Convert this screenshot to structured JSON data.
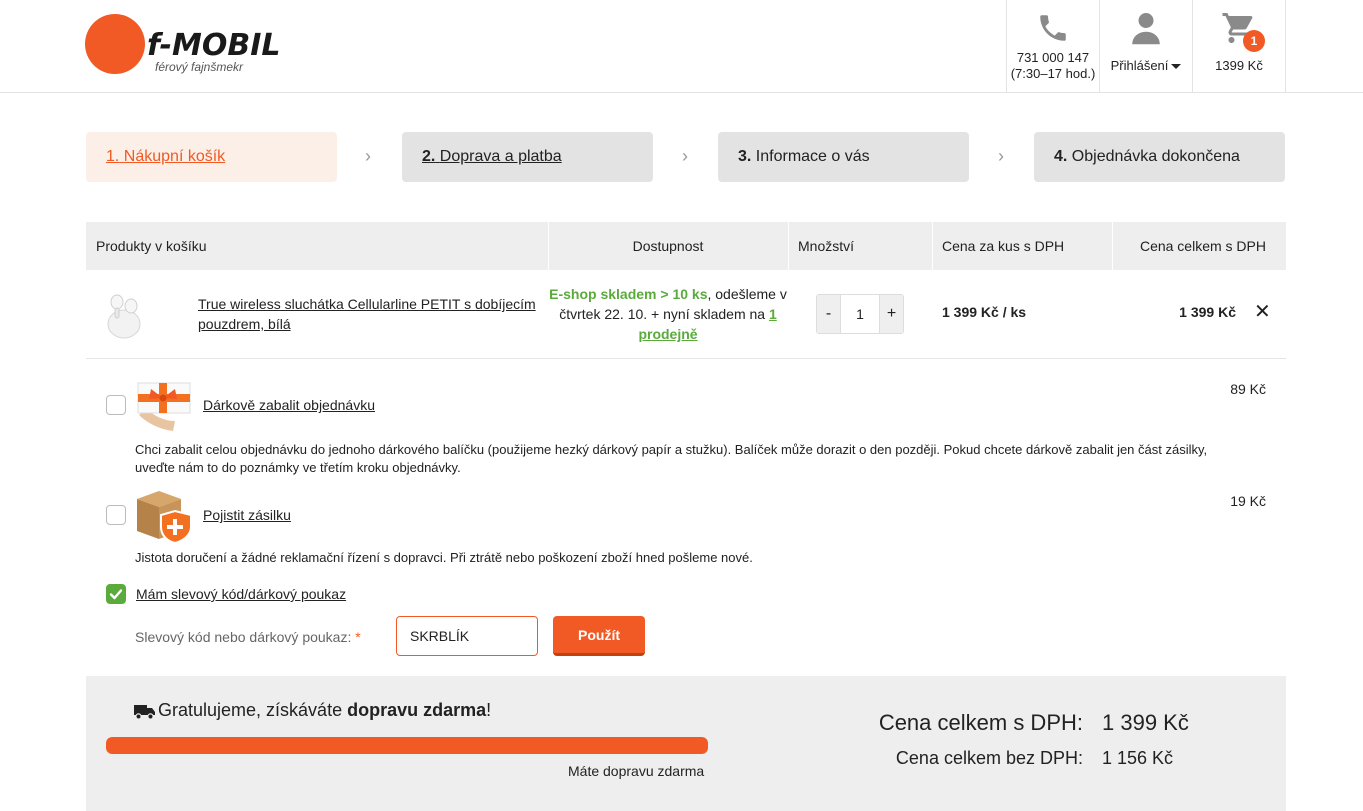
{
  "header": {
    "logo_text": "f-MOBIL",
    "logo_tagline": "férový fajnšmekr",
    "phone_number": "731 000 147",
    "phone_hours": "(7:30–17 hod.)",
    "login_label": "Přihlášení",
    "cart_count": "1",
    "cart_total": "1399 Kč"
  },
  "steps": [
    {
      "num": "1.",
      "label": "Nákupní košík",
      "active": true
    },
    {
      "num": "2.",
      "label": "Doprava a platba",
      "active": false
    },
    {
      "num": "3.",
      "label": "Informace o vás",
      "active": false
    },
    {
      "num": "4.",
      "label": "Objednávka dokončena",
      "active": false
    }
  ],
  "step_separator": "›",
  "table": {
    "headers": {
      "products": "Produkty v košíku",
      "availability": "Dostupnost",
      "quantity": "Množství",
      "unit_price": "Cena za kus s DPH",
      "total_price": "Cena celkem s DPH"
    },
    "item": {
      "name": "True wireless sluchátka Cellularline PETIT s dobíjecím pouzdrem, bílá",
      "stock_main": "E-shop skladem > 10 ks",
      "stock_comma": ",",
      "ship_text": "odešleme v čtvrtek 22. 10. + nyní skladem na",
      "store_link": "1 prodejně",
      "qty_minus": "-",
      "qty_value": "1",
      "qty_plus": "+",
      "unit_price": "1 399 Kč / ks",
      "total_price": "1 399 Kč",
      "remove": "✕"
    }
  },
  "options": {
    "gift": {
      "label": "Dárkově zabalit objednávku",
      "price": "89 Kč",
      "desc": "Chci zabalit celou objednávku do jednoho dárkového balíčku (použijeme hezký dárkový papír a stužku). Balíček může dorazit o den později. Pokud chcete dárkově zabalit jen část zásilky, uveďte nám to do poznámky ve třetím kroku objednávky.",
      "checked": false
    },
    "insurance": {
      "label": "Pojistit zásilku",
      "price": "19 Kč",
      "desc": "Jistota doručení a žádné reklamační řízení s dopravci. Při ztrátě nebo poškození zboží hned pošleme nové.",
      "checked": false
    },
    "coupon": {
      "label": "Mám slevový kód/dárkový poukaz",
      "checked": true,
      "field_label": "Slevový kód nebo dárkový poukaz:",
      "required_mark": "*",
      "value": "SKRBLÍK",
      "apply_label": "Použít"
    }
  },
  "summary": {
    "ship_prefix": "Gratulujeme, získáváte ",
    "ship_bold": "dopravu zdarma",
    "ship_suffix": "!",
    "progress_fraction": 1.0,
    "progress_text": "Máte dopravu zdarma",
    "total_vat_label": "Cena celkem s DPH:",
    "total_vat_value": "1 399 Kč",
    "total_novat_label": "Cena celkem bez DPH:",
    "total_novat_value": "1 156 Kč"
  },
  "colors": {
    "accent": "#f15a24",
    "green": "#5aab3c",
    "panel": "#eeeeee"
  }
}
